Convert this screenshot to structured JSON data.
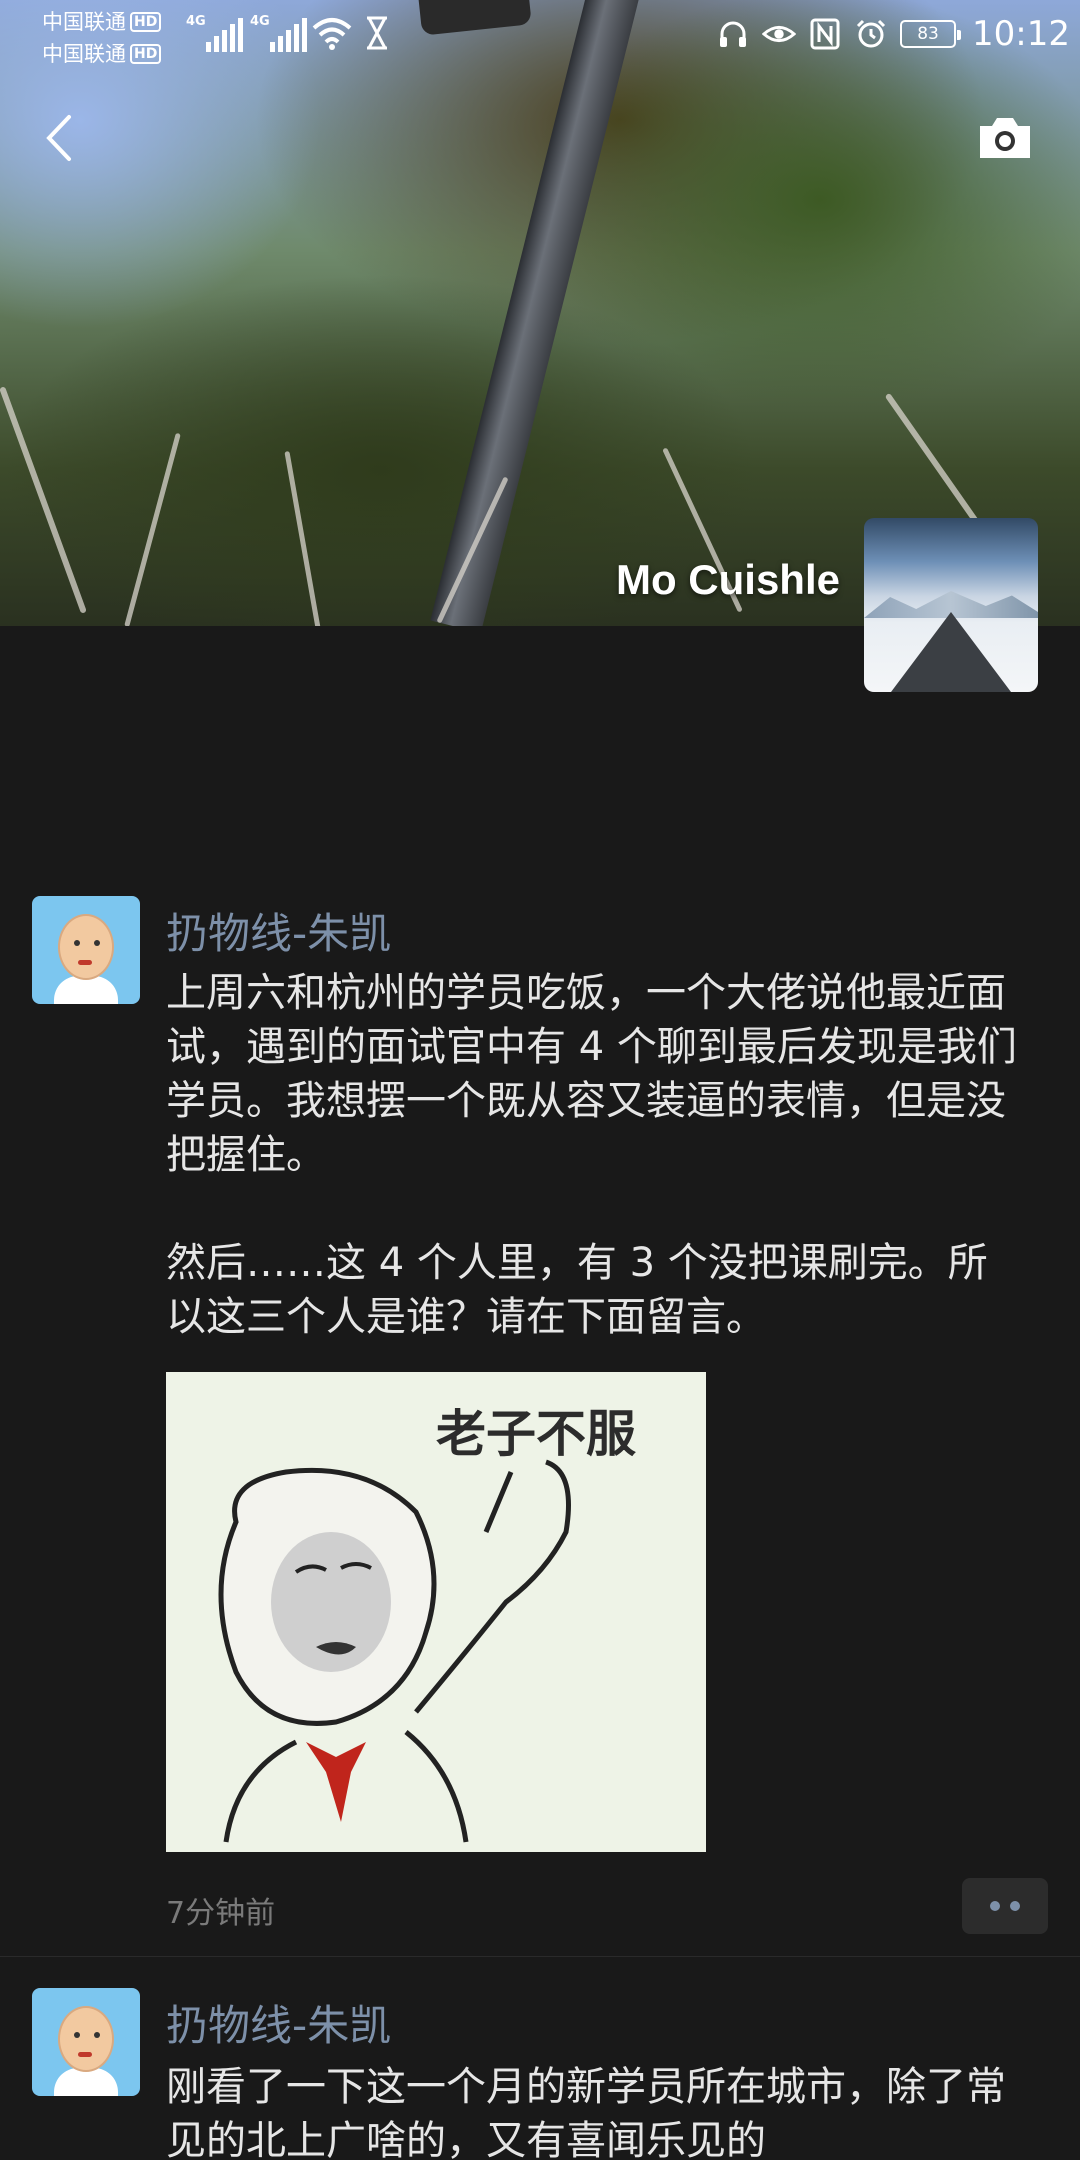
{
  "status_bar": {
    "carrier_1": "中国联通",
    "carrier_2": "中国联通",
    "hd_label": "HD",
    "network_1": "4G",
    "network_2": "4G",
    "battery": "83",
    "time": "10:12",
    "icons": [
      "signal-icon",
      "wifi-icon",
      "hourglass-icon",
      "headphones-icon",
      "eye-icon",
      "nfc-icon",
      "alarm-icon",
      "battery-icon"
    ]
  },
  "header": {
    "back_icon": "back-chevron-icon",
    "camera_icon": "camera-icon",
    "user_name": "Mo Cuishle"
  },
  "posts": [
    {
      "author": "扔物线-朱凯",
      "text": "上周六和杭州的学员吃饭，一个大佬说他最近面试，遇到的面试官中有 4 个聊到最后发现是我们学员。我想摆一个既从容又装逼的表情，但是没把握住。\n\n然后……这 4 个人里，有 3 个没把课刷完。所以这三个人是谁？请在下面留言。",
      "image_caption": "老子不服",
      "time": "7分钟前"
    },
    {
      "author": "扔物线-朱凯",
      "text": "刚看了一下这一个月的新学员所在城市，除了常见的北上广啥的，又有喜闻乐见的"
    }
  ],
  "colors": {
    "background": "#191919",
    "author_name": "#7d90a9",
    "body_text": "#e6e6e6",
    "timestamp": "#7a7a7a"
  }
}
